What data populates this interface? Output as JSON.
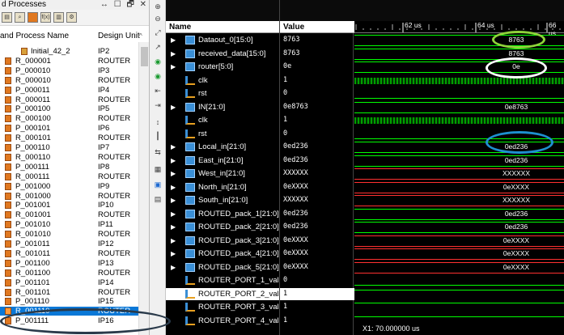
{
  "left_panel": {
    "title": "d Processes",
    "window_buttons": "↔ ☐ 🗗 ✕",
    "columns": {
      "name": "and Process Name",
      "unit": "Design Unit"
    },
    "rows": [
      {
        "name": "Initial_42_2",
        "unit": "IP2"
      },
      {
        "name": "R_000001",
        "unit": "ROUTER"
      },
      {
        "name": "P_000010",
        "unit": "IP3"
      },
      {
        "name": "R_000010",
        "unit": "ROUTER"
      },
      {
        "name": "P_000011",
        "unit": "IP4"
      },
      {
        "name": "R_000011",
        "unit": "ROUTER"
      },
      {
        "name": "P_000100",
        "unit": "IP5"
      },
      {
        "name": "R_000100",
        "unit": "ROUTER"
      },
      {
        "name": "P_000101",
        "unit": "IP6"
      },
      {
        "name": "R_000101",
        "unit": "ROUTER"
      },
      {
        "name": "P_000110",
        "unit": "IP7"
      },
      {
        "name": "R_000110",
        "unit": "ROUTER"
      },
      {
        "name": "P_000111",
        "unit": "IP8"
      },
      {
        "name": "R_000111",
        "unit": "ROUTER"
      },
      {
        "name": "P_001000",
        "unit": "IP9"
      },
      {
        "name": "R_001000",
        "unit": "ROUTER"
      },
      {
        "name": "P_001001",
        "unit": "IP10"
      },
      {
        "name": "R_001001",
        "unit": "ROUTER"
      },
      {
        "name": "P_001010",
        "unit": "IP11"
      },
      {
        "name": "R_001010",
        "unit": "ROUTER"
      },
      {
        "name": "P_001011",
        "unit": "IP12"
      },
      {
        "name": "R_001011",
        "unit": "ROUTER"
      },
      {
        "name": "P_001100",
        "unit": "IP13"
      },
      {
        "name": "R_001100",
        "unit": "ROUTER"
      },
      {
        "name": "P_001101",
        "unit": "IP14"
      },
      {
        "name": "R_001101",
        "unit": "ROUTER"
      },
      {
        "name": "P_001110",
        "unit": "IP15"
      },
      {
        "name": "R_001110",
        "unit": "ROUTER"
      },
      {
        "name": "P_001111",
        "unit": "IP16"
      }
    ],
    "selected_index": 27
  },
  "waveform": {
    "name_header": "Name",
    "value_header": "Value",
    "ruler_ticks": [
      "62 us",
      "64 us",
      "66 us"
    ],
    "cursor_label": "X1: 70.000000 us",
    "selected_index": 19,
    "signals": [
      {
        "name": "Dataout_0[15:0]",
        "value": "8763",
        "kind": "bus",
        "expand": true,
        "wave": "8763",
        "color": "#00ff00"
      },
      {
        "name": "received_data[15:0]",
        "value": "8763",
        "kind": "bus",
        "expand": true,
        "wave": "8763",
        "color": "#00ff00"
      },
      {
        "name": "router[5:0]",
        "value": "0e",
        "kind": "bus",
        "expand": true,
        "wave": "0e",
        "color": "#00ff00"
      },
      {
        "name": "clk",
        "value": "1",
        "kind": "bit",
        "expand": false,
        "wave": "clock",
        "color": "#00ff00"
      },
      {
        "name": "rst",
        "value": "0",
        "kind": "bit",
        "expand": false,
        "wave": "low",
        "color": "#00ff00"
      },
      {
        "name": "IN[21:0]",
        "value": "0e8763",
        "kind": "bus",
        "expand": true,
        "wave": "0e8763",
        "color": "#00ff00"
      },
      {
        "name": "clk",
        "value": "1",
        "kind": "bit",
        "expand": false,
        "wave": "clock",
        "color": "#00ff00"
      },
      {
        "name": "rst",
        "value": "0",
        "kind": "bit",
        "expand": false,
        "wave": "low",
        "color": "#00ff00"
      },
      {
        "name": "Local_in[21:0]",
        "value": "0ed236",
        "kind": "bus",
        "expand": true,
        "wave": "0ed236",
        "color": "#00ff00"
      },
      {
        "name": "East_in[21:0]",
        "value": "0ed236",
        "kind": "bus",
        "expand": true,
        "wave": "0ed236",
        "color": "#00ff00"
      },
      {
        "name": "West_in[21:0]",
        "value": "XXXXXX",
        "kind": "bus",
        "expand": true,
        "wave": "XXXXXX",
        "color": "#ff3030"
      },
      {
        "name": "North_in[21:0]",
        "value": "0eXXXX",
        "kind": "bus",
        "expand": true,
        "wave": "0eXXXX",
        "color": "#ff3030"
      },
      {
        "name": "South_in[21:0]",
        "value": "XXXXXX",
        "kind": "bus",
        "expand": true,
        "wave": "XXXXXX",
        "color": "#ff3030"
      },
      {
        "name": "ROUTED_pack_1[21:0]",
        "value": "0ed236",
        "kind": "bus",
        "expand": true,
        "wave": "0ed236",
        "color": "#00ff00"
      },
      {
        "name": "ROUTED_pack_2[21:0]",
        "value": "0ed236",
        "kind": "bus",
        "expand": true,
        "wave": "0ed236",
        "color": "#00ff00"
      },
      {
        "name": "ROUTED_pack_3[21:0]",
        "value": "0eXXXX",
        "kind": "bus",
        "expand": true,
        "wave": "0eXXXX",
        "color": "#ff3030"
      },
      {
        "name": "ROUTED_pack_4[21:0]",
        "value": "0eXXXX",
        "kind": "bus",
        "expand": true,
        "wave": "0eXXXX",
        "color": "#ff3030"
      },
      {
        "name": "ROUTED_pack_5[21:0]",
        "value": "0eXXXX",
        "kind": "bus",
        "expand": true,
        "wave": "0eXXXX",
        "color": "#ff3030"
      },
      {
        "name": "ROUTER_PORT_1_valid",
        "value": "0",
        "kind": "bit",
        "expand": false,
        "wave": "low",
        "color": "#00ff00"
      },
      {
        "name": "ROUTER_PORT_2_valid",
        "value": "1",
        "kind": "bit",
        "expand": false,
        "wave": "high",
        "color": "#00ff00"
      },
      {
        "name": "ROUTER_PORT_3_valid",
        "value": "1",
        "kind": "bit",
        "expand": false,
        "wave": "high",
        "color": "#00ff00"
      },
      {
        "name": "ROUTER_PORT_4_valid",
        "value": "1",
        "kind": "bit",
        "expand": false,
        "wave": "high",
        "color": "#00ff00"
      }
    ]
  },
  "annotations": {
    "green_ellipse_color": "#8fd33a",
    "white_ellipse_color": "#ffffff",
    "blue_ellipse_color": "#1e90d0",
    "dark_ellipse_color": "#2a3a4a"
  }
}
